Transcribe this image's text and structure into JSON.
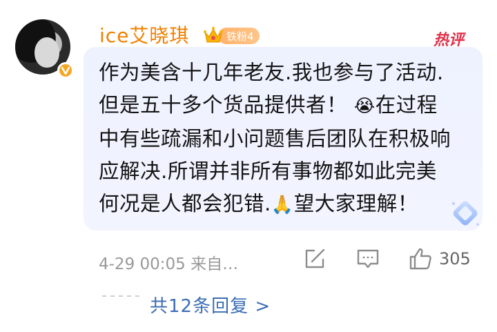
{
  "user": {
    "name": "ice艾晓琪",
    "fan_badge": "铁粉4",
    "avatar_icon": "user-avatar"
  },
  "hot_tag": "热评",
  "comment": {
    "lines": [
      "作为美含十几年老友.我也参与了活动.",
      "但是五十多个货品提供者！",
      "在过程",
      "中有些疏漏和小问题售后团队在积极响",
      "应解决.所谓并非所有事物都如此完美",
      "何况是人都会犯错.",
      "望大家理解！"
    ],
    "emoji_cry": "😭",
    "emoji_pray": "🙏"
  },
  "meta": {
    "time_source": "4-29 00:05 来自…",
    "like_count": "305"
  },
  "replies_link": "共12条回复 >",
  "colors": {
    "username": "#f08000",
    "hot_tag": "#e0314a",
    "link": "#3b6db5"
  }
}
